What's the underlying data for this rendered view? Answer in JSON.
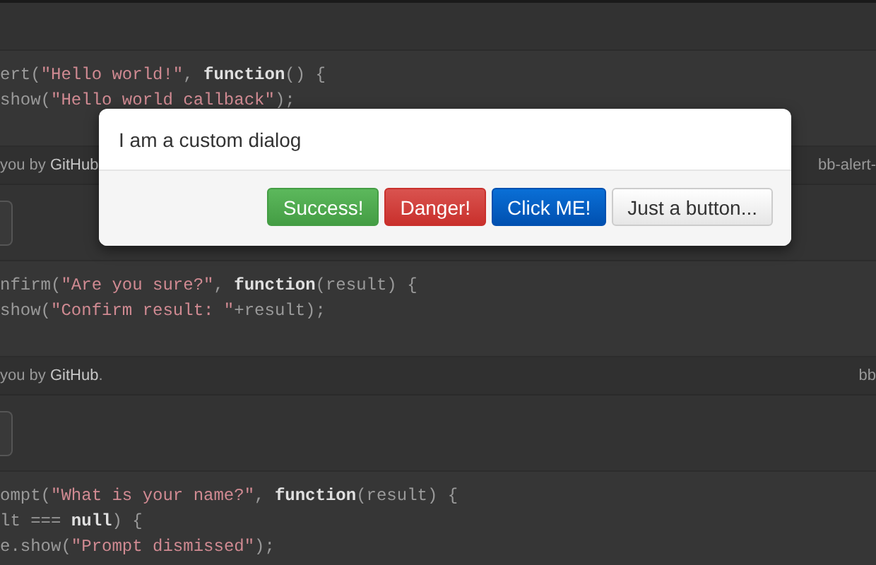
{
  "page": {
    "sections": [
      {
        "has_button_stub": false,
        "code": [
          [
            {
              "kind": "plain",
              "text": "ert("
            },
            {
              "kind": "string",
              "text": "\"Hello world!\""
            },
            {
              "kind": "plain",
              "text": ", "
            },
            {
              "kind": "keyword",
              "text": "function"
            },
            {
              "kind": "plain",
              "text": "() {"
            }
          ],
          [
            {
              "kind": "plain",
              "text": "show("
            },
            {
              "kind": "string",
              "text": "\"Hello world callback\""
            },
            {
              "kind": "plain",
              "text": ");"
            }
          ]
        ],
        "footer": {
          "text": "you by",
          "link": "GitHub",
          "right": "bb-alert-"
        }
      },
      {
        "has_button_stub": true,
        "code": [
          [
            {
              "kind": "plain",
              "text": "nfirm("
            },
            {
              "kind": "string",
              "text": "\"Are you sure?\""
            },
            {
              "kind": "plain",
              "text": ", "
            },
            {
              "kind": "keyword",
              "text": "function"
            },
            {
              "kind": "plain",
              "text": "(result) {"
            }
          ],
          [
            {
              "kind": "plain",
              "text": "show("
            },
            {
              "kind": "string",
              "text": "\"Confirm result: \""
            },
            {
              "kind": "plain",
              "text": "+result);"
            }
          ]
        ],
        "footer": {
          "text": "you by",
          "link": "GitHub",
          "tail": ".",
          "right": "bb"
        }
      },
      {
        "has_button_stub": true,
        "code": [
          [
            {
              "kind": "plain",
              "text": "ompt("
            },
            {
              "kind": "string",
              "text": "\"What is your name?\""
            },
            {
              "kind": "plain",
              "text": ", "
            },
            {
              "kind": "keyword",
              "text": "function"
            },
            {
              "kind": "plain",
              "text": "(result) {"
            }
          ],
          [
            {
              "kind": "plain",
              "text": "lt === "
            },
            {
              "kind": "keyword",
              "text": "null"
            },
            {
              "kind": "plain",
              "text": ") {"
            }
          ],
          [
            {
              "kind": "plain",
              "text": "e.show("
            },
            {
              "kind": "string",
              "text": "\"Prompt dismissed\""
            },
            {
              "kind": "plain",
              "text": ");"
            }
          ]
        ]
      }
    ]
  },
  "dialog": {
    "message": "I am a custom dialog",
    "buttons": [
      {
        "label": "Success!",
        "kind": "success"
      },
      {
        "label": "Danger!",
        "kind": "danger"
      },
      {
        "label": "Click ME!",
        "kind": "primary"
      },
      {
        "label": "Just a button...",
        "kind": "default"
      }
    ]
  }
}
